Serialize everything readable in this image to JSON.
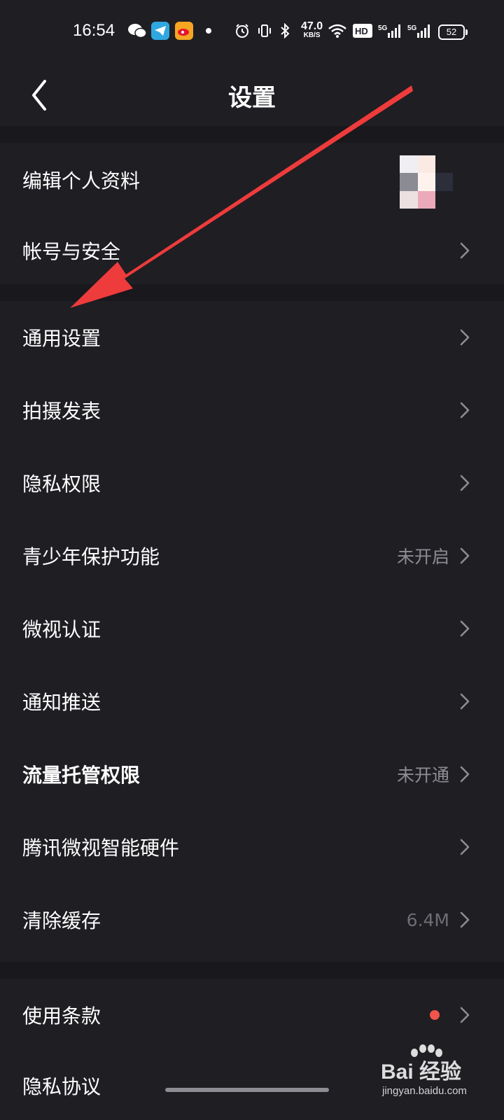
{
  "status_bar": {
    "time": "16:54",
    "net_speed_value": "47.0",
    "net_speed_unit": "KB/S",
    "battery": "52",
    "icons": [
      "wechat-icon",
      "telegram-icon",
      "weibo-icon",
      "dot-icon",
      "alarm-icon",
      "vibrate-icon",
      "bluetooth-icon",
      "wifi-icon",
      "hd-icon",
      "signal-5g-icon",
      "signal-5g-icon"
    ]
  },
  "header": {
    "title": "设置",
    "back_icon": "chevron-left-icon"
  },
  "group1": [
    {
      "label": "编辑个人资料"
    },
    {
      "label": "帐号与安全"
    }
  ],
  "group2": [
    {
      "label": "通用设置"
    },
    {
      "label": "拍摄发表"
    },
    {
      "label": "隐私权限"
    },
    {
      "label": "青少年保护功能",
      "value": "未开启"
    },
    {
      "label": "微视认证"
    },
    {
      "label": "通知推送"
    },
    {
      "label": "流量托管权限",
      "value": "未开通"
    },
    {
      "label": "腾讯微视智能硬件"
    },
    {
      "label": "清除缓存",
      "value": "6.4M"
    }
  ],
  "group3": [
    {
      "label": "使用条款"
    },
    {
      "label": "隐私协议"
    }
  ],
  "watermark": {
    "brand": "Bai 经验",
    "url": "jingyan.baidu.com"
  },
  "colors": {
    "background": "#1f1e23",
    "divider": "#19181c",
    "value_text": "#8d8c92",
    "red_dot": "#f0544a",
    "annotation_arrow": "#ee3b3b"
  }
}
